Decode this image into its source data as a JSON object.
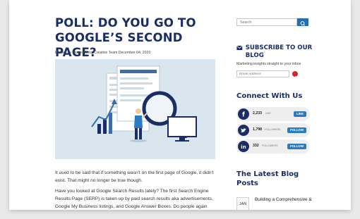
{
  "post": {
    "title": "POLL: DO YOU GO TO GOOGLE’S SECOND PAGE?",
    "meta": "Posted by ImageWorks Creative Team December 04, 2020",
    "paragraph1": "It used to be said that if something wasn't on the first page of Google, it didn't exist. That might no longer be true though.",
    "paragraph2": "Have you looked at Google Search Results lately? The first Search Engine Results Page (SERP) is taken up by paid search results aka advertisements, Google My Business listings, and Google Answer Boxes. Do people again"
  },
  "sidebar": {
    "search_placeholder": "Search",
    "subscribe_title": "SUBSCRIBE TO OUR BLOG",
    "subscribe_text": "Marketing insights straight to your inbox",
    "email_placeholder": "Email Address",
    "connect_title": "Connect With Us",
    "social": [
      {
        "count": "2,233",
        "label": "LIKE",
        "button": "LIKE",
        "icon": "facebook-icon"
      },
      {
        "count": "1,798",
        "label": "FOLLOWERS",
        "button": "FOLLOW",
        "icon": "twitter-icon"
      },
      {
        "count": "332",
        "label": "FOLLOWERS",
        "button": "FOLLOW",
        "icon": "linkedin-icon"
      }
    ],
    "latest_title": "The Latest Blog Posts",
    "latest_post": {
      "month": "JAN",
      "title": "Building a Comprehensive &"
    }
  },
  "colors": {
    "navy": "#1a2d64",
    "blue": "#2a7bc0",
    "red": "#d8232a"
  }
}
